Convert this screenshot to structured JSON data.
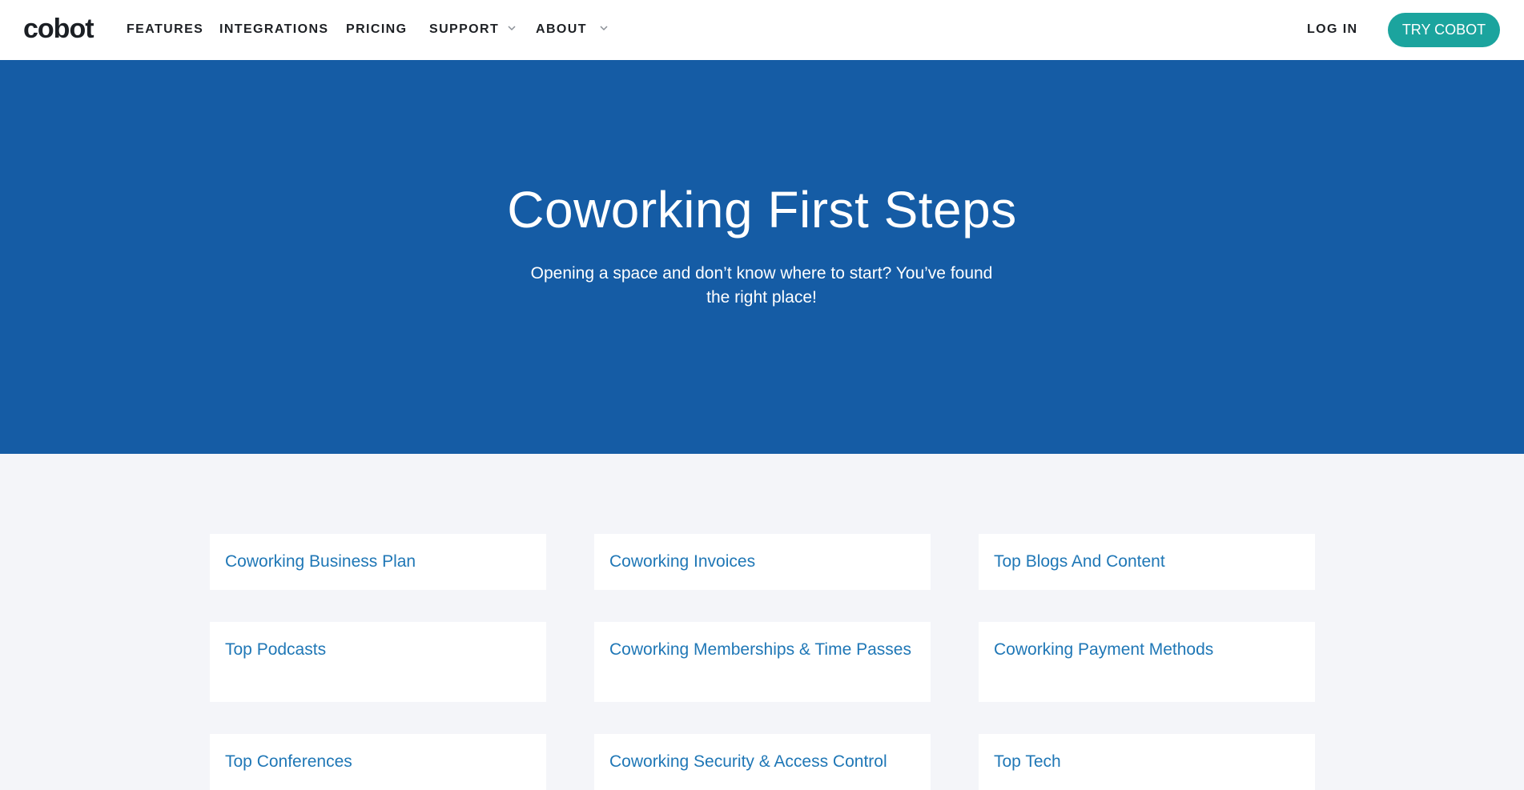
{
  "nav": {
    "logo": "cobot",
    "links": [
      "FEATURES",
      "INTEGRATIONS",
      "PRICING",
      "SUPPORT",
      "ABOUT"
    ],
    "login": "LOG IN",
    "cta": "TRY COBOT"
  },
  "hero": {
    "title": "Coworking First Steps",
    "subtitle": "Opening a space and don’t know where to start? You’ve found the right place!"
  },
  "cards": [
    "Coworking Business Plan",
    "Coworking Invoices",
    "Top Blogs And Content",
    "Top Podcasts",
    "Coworking Memberships & Time Passes",
    "Coworking Payment Methods",
    "Top Conferences",
    "Coworking Security & Access Control",
    "Top Tech"
  ],
  "colors": {
    "hero_bg": "#155ca5",
    "cta_bg": "#1ba49e",
    "link": "#1f77b6",
    "page_bg": "#f4f5f9"
  }
}
